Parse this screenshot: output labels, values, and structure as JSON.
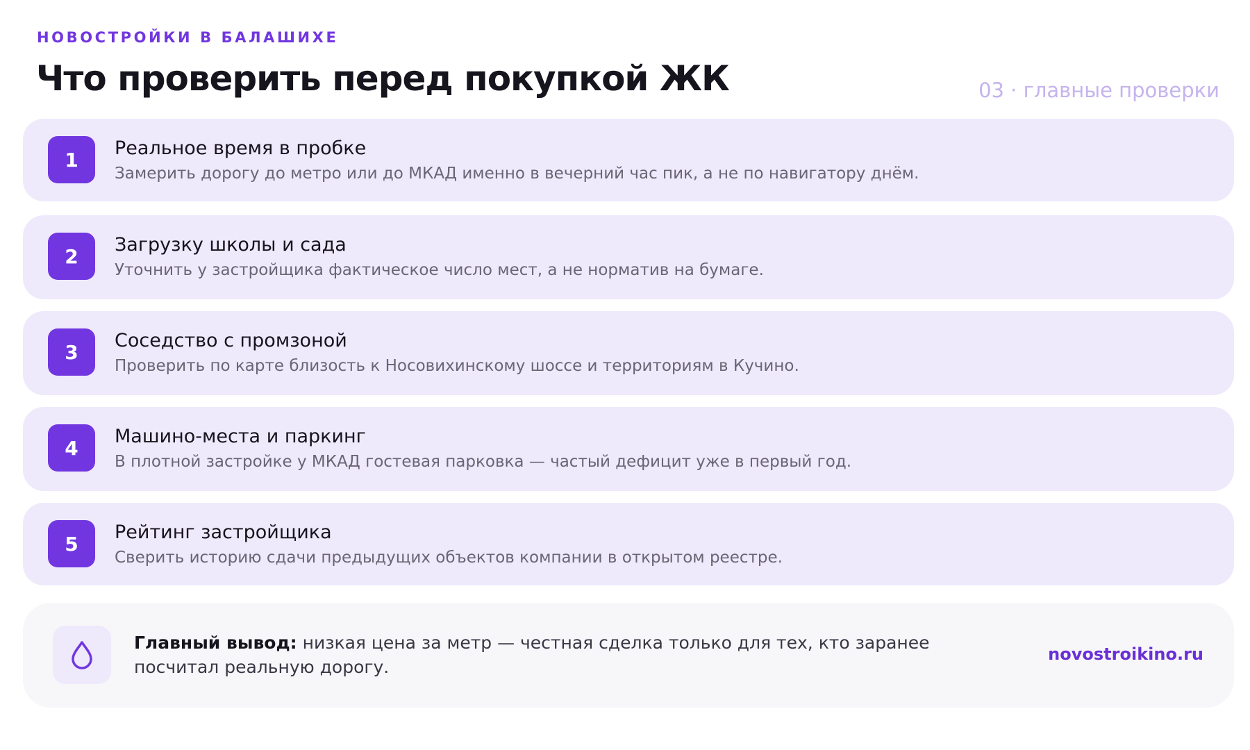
{
  "header": {
    "eyebrow": "НОВОСТРОЙКИ В БАЛАШИХЕ",
    "title": "Что проверить перед покупкой ЖК",
    "counter": "03 · главные проверки"
  },
  "checks": [
    {
      "number": "1",
      "title": "Реальное время в пробке",
      "description": "Замерить дорогу до метро или до МКАД именно в вечерний час пик, а не по навигатору днём."
    },
    {
      "number": "2",
      "title": "Загрузку школы и сада",
      "description": "Уточнить у застройщика фактическое число мест, а не норматив на бумаге."
    },
    {
      "number": "3",
      "title": "Соседство с промзоной",
      "description": "Проверить по карте близость к Носовихинскому шоссе и территориям в Кучино."
    },
    {
      "number": "4",
      "title": "Машино-места и паркинг",
      "description": "В плотной застройке у МКАД гостевая парковка — частый дефицит уже в первый год."
    },
    {
      "number": "5",
      "title": "Рейтинг застройщика",
      "description": "Сверить историю сдачи предыдущих объектов компании в открытом реестре."
    }
  ],
  "conclusion": {
    "icon": "drop-icon",
    "lead": "Главный вывод:",
    "text": " низкая цена за метр — честная сделка только для тех, кто заранее посчитал реальную дорогу.",
    "brand": "novostroikino.ru"
  },
  "colors": {
    "accent": "#7136e0",
    "card": "#efe9fc",
    "muted": "#696674"
  }
}
